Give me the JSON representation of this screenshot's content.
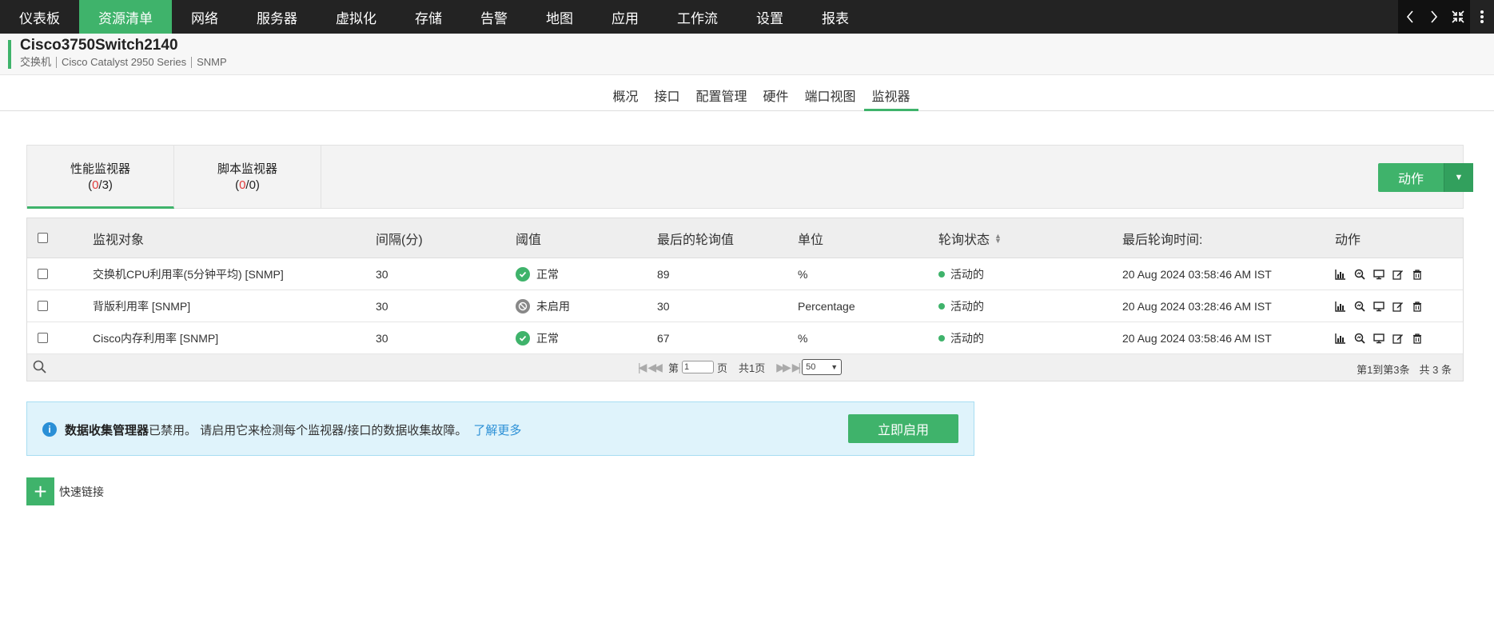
{
  "nav": {
    "items": [
      "仪表板",
      "资源清单",
      "网络",
      "服务器",
      "虚拟化",
      "存储",
      "告警",
      "地图",
      "应用",
      "工作流",
      "设置",
      "报表"
    ],
    "active": "资源清单"
  },
  "device": {
    "name": "Cisco3750Switch2140",
    "type": "交换机",
    "model": "Cisco Catalyst 2950 Series",
    "protocol": "SNMP"
  },
  "subtabs": [
    "概况",
    "接口",
    "配置管理",
    "硬件",
    "端口视图",
    "监视器"
  ],
  "monitor_tabs": [
    {
      "label": "性能监视器",
      "count_red": "0",
      "count_total": "3"
    },
    {
      "label": "脚本监视器",
      "count_red": "0",
      "count_total": "0"
    }
  ],
  "action_button": "动作",
  "table": {
    "headers": [
      "监视对象",
      "间隔(分)",
      "阈值",
      "最后的轮询值",
      "单位",
      "轮询状态",
      "最后轮询时间:",
      "动作"
    ],
    "rows": [
      {
        "name": "交换机CPU利用率(5分钟平均) [SNMP]",
        "interval": "30",
        "threshold": "正常",
        "threshold_state": "ok",
        "value": "89",
        "unit": "%",
        "status": "活动的",
        "time": "20 Aug 2024 03:58:46 AM IST"
      },
      {
        "name": "背版利用率 [SNMP]",
        "interval": "30",
        "threshold": "未启用",
        "threshold_state": "disabled",
        "value": "30",
        "unit": "Percentage",
        "status": "活动的",
        "time": "20 Aug 2024 03:28:46 AM IST"
      },
      {
        "name": "Cisco内存利用率 [SNMP]",
        "interval": "30",
        "threshold": "正常",
        "threshold_state": "ok",
        "value": "67",
        "unit": "%",
        "status": "活动的",
        "time": "20 Aug 2024 03:58:46 AM IST"
      }
    ]
  },
  "pager": {
    "page_prefix": "第",
    "page_value": "1",
    "page_suffix": "页",
    "total_pages": "共1页",
    "page_size": "50",
    "range": "第1到第3条",
    "total": "共 3 条"
  },
  "banner": {
    "bold": "数据收集管理器",
    "text": "已禁用。 请启用它来检测每个监视器/接口的数据收集故障。",
    "link": "了解更多",
    "button": "立即启用"
  },
  "quick_link": "快速链接",
  "colors": {
    "accent": "#3fb36b",
    "nav_bg": "#232323",
    "info_blue": "#2a8fd6",
    "alert_red": "#e03b3b"
  }
}
